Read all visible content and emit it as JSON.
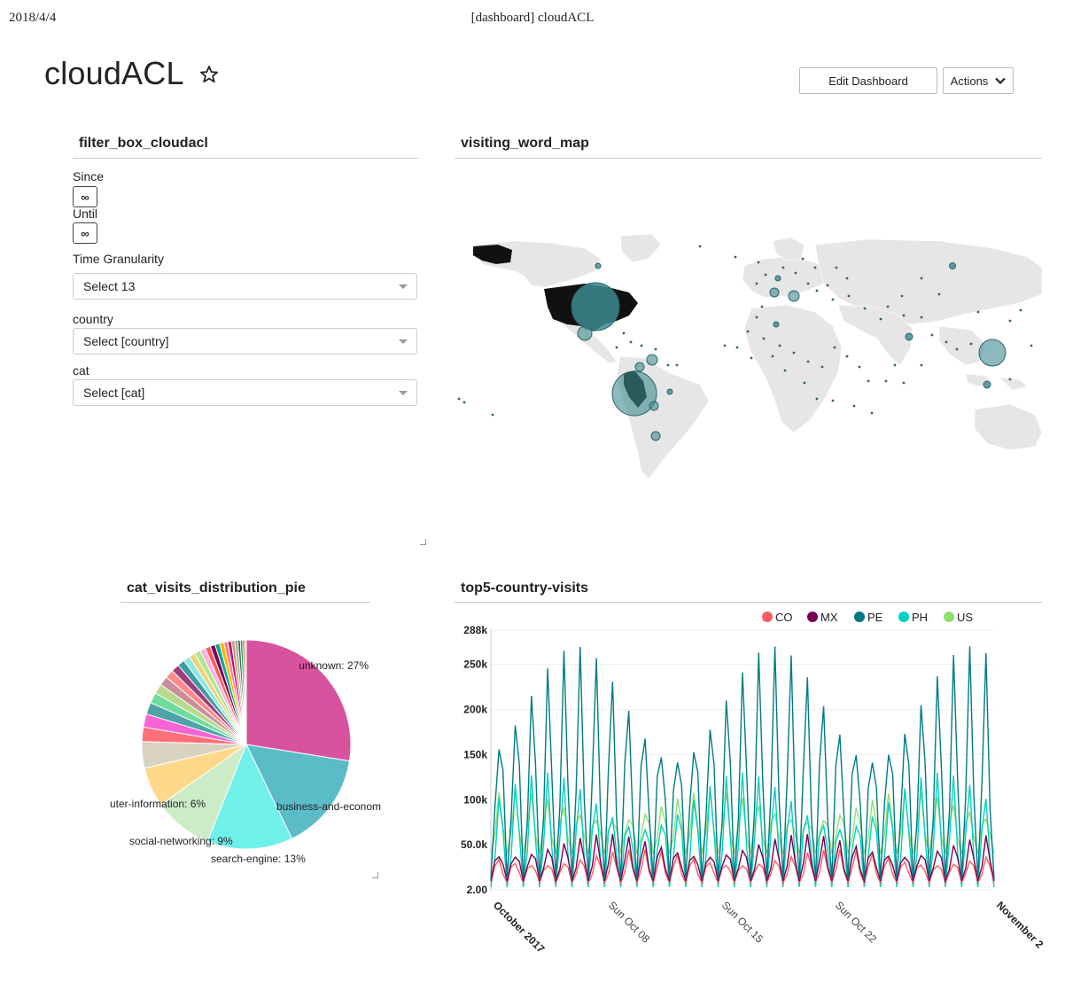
{
  "print_header": {
    "date": "2018/4/4",
    "title": "[dashboard] cloudACL"
  },
  "dashboard": {
    "title": "cloudACL",
    "star_icon": "star-outline-icon",
    "edit_button": "Edit Dashboard",
    "actions_button": "Actions",
    "actions_icon": "chevron-down-icon"
  },
  "filter_box": {
    "title": "filter_box_cloudacl",
    "since_label": "Since",
    "since_value": "∞",
    "until_label": "Until",
    "until_value": "∞",
    "granularity_label": "Time Granularity",
    "granularity_value": "Select 13",
    "country_label": "country",
    "country_placeholder": "Select [country]",
    "cat_label": "cat",
    "cat_placeholder": "Select [cat]"
  },
  "map_panel": {
    "title": "visiting_word_map"
  },
  "pie_panel": {
    "title": "cat_visits_distribution_pie"
  },
  "line_panel": {
    "title": "top5-country-visits"
  },
  "colors": {
    "map_land": "#e6e6e6",
    "map_highlight": "#111111",
    "bubble": "#3d8a90",
    "CO": "#ff5a5f",
    "MX": "#7b0051",
    "PE": "#007a87",
    "PH": "#00d1c1",
    "US": "#8ce071"
  },
  "chart_data": [
    {
      "type": "pie",
      "title": "cat_visits_distribution_pie",
      "slices": [
        {
          "label": "unknown: 27%",
          "value": 27,
          "color": "#d8539e"
        },
        {
          "label": "business-and-econom",
          "value": 15,
          "color": "#5bbcc8"
        },
        {
          "label": "search-engine: 13%",
          "value": 13,
          "color": "#6ff0e8"
        },
        {
          "label": "social-networking: 9%",
          "value": 9,
          "color": "#ccecc8"
        },
        {
          "label": "uter-information: 6%",
          "value": 6,
          "color": "#ffd98a"
        },
        {
          "label": "",
          "value": 4,
          "color": "#d8d2c0"
        },
        {
          "label": "",
          "value": 2.2,
          "color": "#ff6f7a"
        },
        {
          "label": "",
          "value": 2.0,
          "color": "#f864d4"
        },
        {
          "label": "",
          "value": 1.8,
          "color": "#4ea4a6"
        },
        {
          "label": "",
          "value": 1.6,
          "color": "#6fdc9c"
        },
        {
          "label": "",
          "value": 1.5,
          "color": "#b9d98e"
        },
        {
          "label": "",
          "value": 1.4,
          "color": "#c88f9a"
        },
        {
          "label": "",
          "value": 1.3,
          "color": "#ff8a8a"
        },
        {
          "label": "",
          "value": 1.2,
          "color": "#9c3f7c"
        },
        {
          "label": "",
          "value": 1.1,
          "color": "#3c9aa0"
        },
        {
          "label": "",
          "value": 1.0,
          "color": "#8ee8e0"
        },
        {
          "label": "",
          "value": 0.95,
          "color": "#f0d27a"
        },
        {
          "label": "",
          "value": 0.9,
          "color": "#a8e890"
        },
        {
          "label": "",
          "value": 0.85,
          "color": "#ffb0e0"
        },
        {
          "label": "",
          "value": 0.8,
          "color": "#ff5a5f"
        },
        {
          "label": "",
          "value": 0.75,
          "color": "#7b0051"
        },
        {
          "label": "",
          "value": 0.7,
          "color": "#00a699"
        },
        {
          "label": "",
          "value": 0.65,
          "color": "#ffb400"
        },
        {
          "label": "",
          "value": 0.6,
          "color": "#ff8083"
        },
        {
          "label": "",
          "value": 0.55,
          "color": "#cc0086"
        },
        {
          "label": "",
          "value": 0.5,
          "color": "#b4a76c"
        },
        {
          "label": "",
          "value": 0.45,
          "color": "#9ca299"
        },
        {
          "label": "",
          "value": 0.4,
          "color": "#565a5c"
        },
        {
          "label": "",
          "value": 0.35,
          "color": "#00a04b"
        },
        {
          "label": "",
          "value": 0.3,
          "color": "#e54c20"
        },
        {
          "label": "",
          "value": 0.25,
          "color": "#ccc"
        }
      ]
    },
    {
      "type": "line",
      "title": "top5-country-visits",
      "xlabel": "",
      "ylabel": "",
      "y_ticks": [
        "288k",
        "250k",
        "200k",
        "150k",
        "100k",
        "50.0k",
        "2.00"
      ],
      "ylim": [
        2,
        288000
      ],
      "x_ticks": [
        {
          "label": "October 2017",
          "bold": true
        },
        {
          "label": "Sun Oct 08",
          "bold": false
        },
        {
          "label": "Sun Oct 15",
          "bold": false
        },
        {
          "label": "Sun Oct 22",
          "bold": false
        },
        {
          "label": "November 2",
          "bold": true
        }
      ],
      "series": [
        {
          "name": "CO",
          "trough": 8000,
          "peak": 45000,
          "color": "#ff5a5f"
        },
        {
          "name": "MX",
          "trough": 10000,
          "peak": 62000,
          "color": "#7b0051"
        },
        {
          "name": "PE",
          "trough": 12000,
          "peak": 270000,
          "color": "#007a87"
        },
        {
          "name": "PH",
          "trough": 3000,
          "peak": 130000,
          "color": "#00d1c1"
        },
        {
          "name": "US",
          "trough": 40000,
          "peak": 110000,
          "color": "#8ce071"
        }
      ]
    }
  ]
}
